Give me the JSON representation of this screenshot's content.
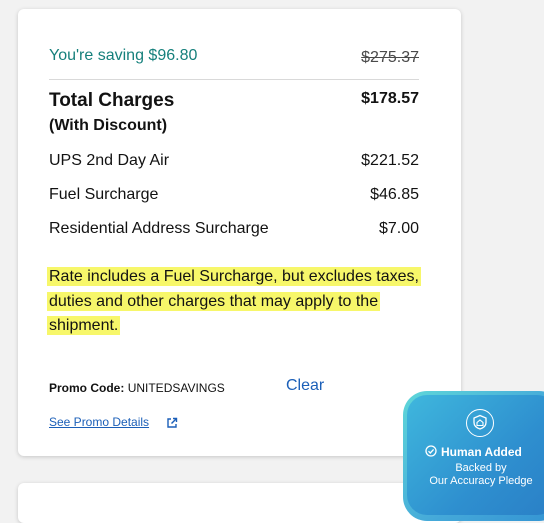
{
  "savings": {
    "label": "You're saving $96.80",
    "original_price": "$275.37",
    "accent_color": "#16807c"
  },
  "total": {
    "title": "Total Charges",
    "subtitle": "(With Discount)",
    "amount": "$178.57"
  },
  "line_items": [
    {
      "label": "UPS 2nd Day Air",
      "amount": "$221.52"
    },
    {
      "label": "Fuel Surcharge",
      "amount": "$46.85"
    },
    {
      "label": "Residential Address Surcharge",
      "amount": "$7.00"
    }
  ],
  "note": {
    "text": "Rate includes a Fuel Surcharge, but excludes taxes, duties and other charges that may apply to the shipment.",
    "highlight_color": "#f7f76a"
  },
  "promo": {
    "label": "Promo Code:",
    "code": "UNITEDSAVINGS",
    "clear_label": "Clear",
    "details_label": "See Promo Details",
    "link_color": "#1b5fb8",
    "details_icon": "external-link-icon"
  },
  "badge": {
    "title": "Human Added",
    "subtitle_line1": "Backed by",
    "subtitle_line2": "Our Accuracy Pledge",
    "icons": [
      "shield-house-icon",
      "check-circle-icon"
    ]
  }
}
